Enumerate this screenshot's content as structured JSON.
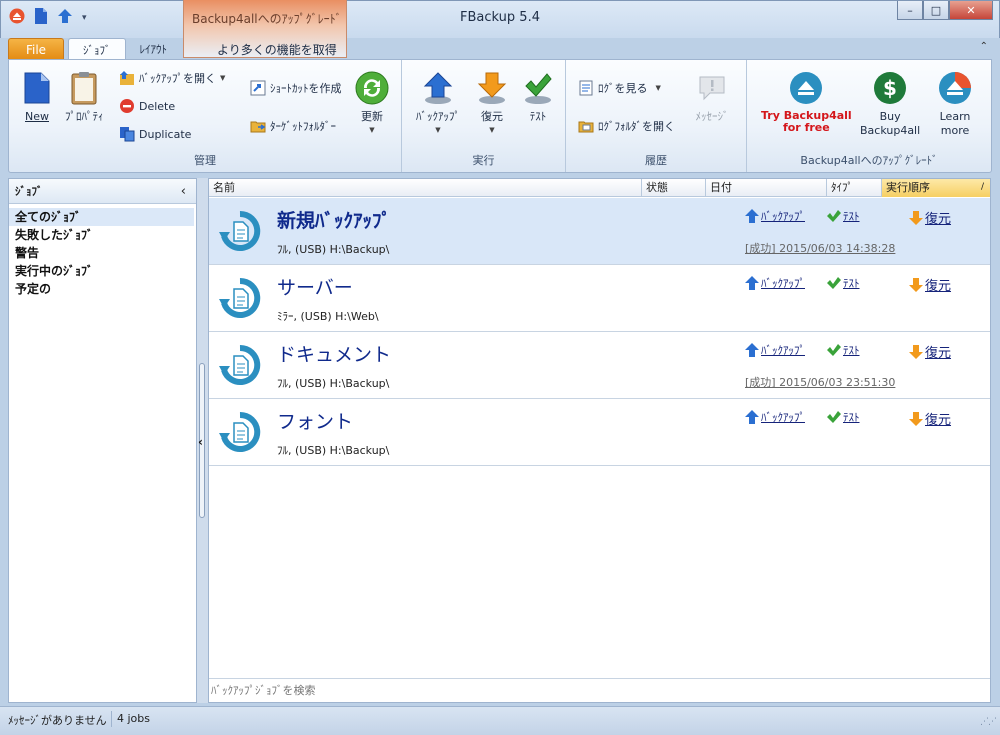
{
  "window": {
    "title": "FBackup 5.4",
    "upgrade_tab_label": "Backup4allへのｱｯﾌﾟｸﾞﾚｰﾄﾞ",
    "controls": {
      "minimize": "–",
      "maximize": "□",
      "close": "✕"
    }
  },
  "tabs": {
    "file": "File",
    "job": "ｼﾞｮﾌﾞ",
    "layout": "ﾚｲｱｳﾄ",
    "upgrade": "より多くの機能を取得"
  },
  "ribbon": {
    "manage": {
      "label": "管理",
      "new": "New",
      "properties": "ﾌﾟﾛﾊﾟﾃｨ",
      "open_backup": "ﾊﾞｯｸｱｯﾌﾟを開く",
      "delete": "Delete",
      "duplicate": "Duplicate",
      "create_shortcut": "ｼｮｰﾄｶｯﾄを作成",
      "target_folder": "ﾀｰｹﾞｯﾄﾌｫﾙﾀﾞｰ",
      "refresh": "更新"
    },
    "run": {
      "label": "実行",
      "backup": "ﾊﾞｯｸｱｯﾌﾟ",
      "restore": "復元",
      "test": "ﾃｽﾄ"
    },
    "history": {
      "label": "履歴",
      "view_log": "ﾛｸﾞを見る",
      "open_log_folder": "ﾛｸﾞﾌｫﾙﾀﾞを開く",
      "messages": "ﾒｯｾｰｼﾞ"
    },
    "upgrade": {
      "label": "Backup4allへのｱｯﾌﾟｸﾞﾚｰﾄﾞ",
      "try_line1": "Try Backup4all",
      "try_line2": "for free",
      "buy_line1": "Buy",
      "buy_line2": "Backup4all",
      "learn_line1": "Learn",
      "learn_line2": "more"
    }
  },
  "left_panel": {
    "title": "ｼﾞｮﾌﾞ",
    "items": [
      "全てのｼﾞｮﾌﾞ",
      "失敗したｼﾞｮﾌﾞ",
      "警告",
      "実行中のｼﾞｮﾌﾞ",
      "予定の"
    ]
  },
  "columns": {
    "name": "名前",
    "state": "状態",
    "date": "日付",
    "type": "ﾀｲﾌﾟ",
    "run_order": "実行順序"
  },
  "actions": {
    "backup": "ﾊﾞｯｸｱｯﾌﾟ",
    "test": "ﾃｽﾄ",
    "restore": "復元"
  },
  "jobs": [
    {
      "name": "新規ﾊﾞｯｸｱｯﾌﾟ",
      "details": "ﾌﾙ, (USB) H:\\Backup\\",
      "status": "[成功] 2015/06/03 14:38:28"
    },
    {
      "name": "サーバー",
      "details": "ﾐﾗｰ, (USB) H:\\Web\\",
      "status": ""
    },
    {
      "name": "ドキュメント",
      "details": "ﾌﾙ, (USB) H:\\Backup\\",
      "status": "[成功] 2015/06/03 23:51:30"
    },
    {
      "name": "フォント",
      "details": "ﾌﾙ, (USB) H:\\Backup\\",
      "status": ""
    }
  ],
  "search": {
    "placeholder": "ﾊﾞｯｸｱｯﾌﾟｼﾞｮﾌﾞを検索"
  },
  "statusbar": {
    "message": "ﾒｯｾｰｼﾞがありません",
    "count": "4 jobs"
  },
  "colors": {
    "accent": "#2b8fc0",
    "job_name": "#102a8c",
    "try_red": "#d4161b",
    "buy_green": "#1f7a3a"
  }
}
